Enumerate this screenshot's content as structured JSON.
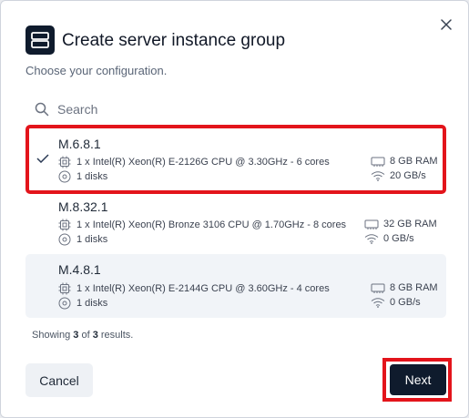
{
  "dialog": {
    "title": "Create server instance group",
    "subtitle": "Choose your configuration.",
    "icons": {
      "header": "server-icon",
      "close": "close-icon"
    }
  },
  "search": {
    "placeholder": "Search",
    "icon": "search-icon"
  },
  "instances": [
    {
      "name": "M.6.8.1",
      "cpu": "1 x Intel(R) Xeon(R) E-2126G CPU @ 3.30GHz - 6 cores",
      "disks": "1 disks",
      "ram": "8 GB RAM",
      "network": "20 GB/s",
      "selected": true
    },
    {
      "name": "M.8.32.1",
      "cpu": "1 x Intel(R) Xeon(R) Bronze 3106 CPU @ 1.70GHz - 8 cores",
      "disks": "1 disks",
      "ram": "32 GB RAM",
      "network": "0 GB/s",
      "selected": false
    },
    {
      "name": "M.4.8.1",
      "cpu": "1 x Intel(R) Xeon(R) E-2144G CPU @ 3.60GHz - 4 cores",
      "disks": "1 disks",
      "ram": "8 GB RAM",
      "network": "0 GB/s",
      "selected": false
    }
  ],
  "results": {
    "prefix": "Showing ",
    "shown": "3",
    "middle": " of ",
    "total": "3",
    "suffix": " results."
  },
  "footer": {
    "cancel_label": "Cancel",
    "next_label": "Next"
  },
  "colors": {
    "primary": "#0f1b2d",
    "highlight": "#e3141b",
    "row_alt": "#f1f4f8"
  }
}
